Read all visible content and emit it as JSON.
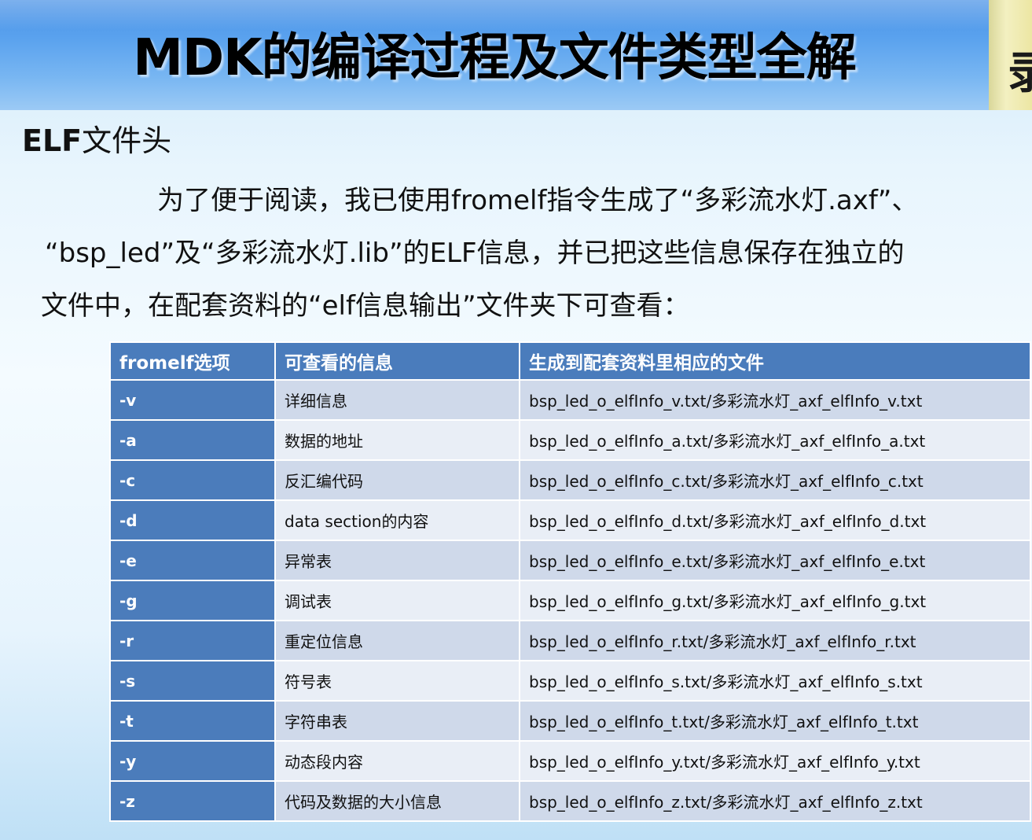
{
  "header": {
    "title": "MDK的编译过程及文件类型全解",
    "corner_text": "录"
  },
  "section": {
    "heading_latin": "ELF",
    "heading_rest": "文件头"
  },
  "paragraph": {
    "line1": "为了便于阅读，我已使用fromelf指令生成了“多彩流水灯.axf”、",
    "line2": "“bsp_led”及“多彩流水灯.lib”的ELF信息，并已把这些信息保存在独立的",
    "line3": "文件中，在配套资料的“elf信息输出”文件夹下可查看："
  },
  "table": {
    "headers": [
      "fromelf选项",
      "可查看的信息",
      "生成到配套资料里相应的文件"
    ],
    "rows": [
      [
        "-v",
        "详细信息",
        "bsp_led_o_elfInfo_v.txt/多彩流水灯_axf_elfInfo_v.txt"
      ],
      [
        "-a",
        "数据的地址",
        "bsp_led_o_elfInfo_a.txt/多彩流水灯_axf_elfInfo_a.txt"
      ],
      [
        "-c",
        "反汇编代码",
        "bsp_led_o_elfInfo_c.txt/多彩流水灯_axf_elfInfo_c.txt"
      ],
      [
        "-d",
        "data section的内容",
        "bsp_led_o_elfInfo_d.txt/多彩流水灯_axf_elfInfo_d.txt"
      ],
      [
        "-e",
        "异常表",
        "bsp_led_o_elfInfo_e.txt/多彩流水灯_axf_elfInfo_e.txt"
      ],
      [
        "-g",
        "调试表",
        "bsp_led_o_elfInfo_g.txt/多彩流水灯_axf_elfInfo_g.txt"
      ],
      [
        "-r",
        "重定位信息",
        "bsp_led_o_elfInfo_r.txt/多彩流水灯_axf_elfInfo_r.txt"
      ],
      [
        "-s",
        "符号表",
        "bsp_led_o_elfInfo_s.txt/多彩流水灯_axf_elfInfo_s.txt"
      ],
      [
        "-t",
        "字符串表",
        "bsp_led_o_elfInfo_t.txt/多彩流水灯_axf_elfInfo_t.txt"
      ],
      [
        "-y",
        "动态段内容",
        "bsp_led_o_elfInfo_y.txt/多彩流水灯_axf_elfInfo_y.txt"
      ],
      [
        "-z",
        "代码及数据的大小信息",
        "bsp_led_o_elfInfo_z.txt/多彩流水灯_axf_elfInfo_z.txt"
      ]
    ]
  },
  "colors": {
    "header_blue": "#4a7cbc",
    "row_light": "#e9eef6",
    "row_mid": "#cfd9ea",
    "title_bar": "#5aa2ee"
  }
}
